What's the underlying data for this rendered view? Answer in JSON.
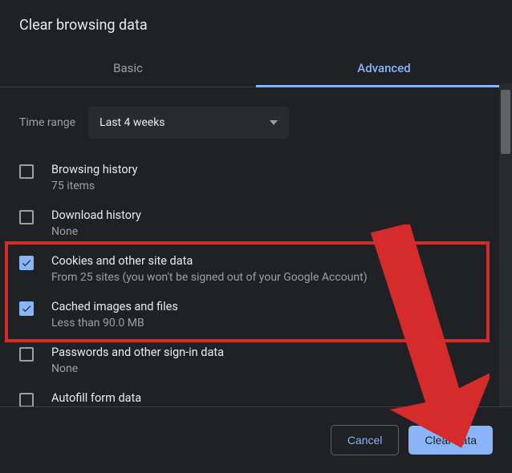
{
  "title": "Clear browsing data",
  "tabs": {
    "basic": "Basic",
    "advanced": "Advanced"
  },
  "time": {
    "label": "Time range",
    "value": "Last 4 weeks"
  },
  "items": [
    {
      "title": "Browsing history",
      "sub": "75 items",
      "checked": false
    },
    {
      "title": "Download history",
      "sub": "None",
      "checked": false
    },
    {
      "title": "Cookies and other site data",
      "sub": "From 25 sites (you won't be signed out of your Google Account)",
      "checked": true
    },
    {
      "title": "Cached images and files",
      "sub": "Less than 90.0 MB",
      "checked": true
    },
    {
      "title": "Passwords and other sign-in data",
      "sub": "None",
      "checked": false
    },
    {
      "title": "Autofill form data",
      "sub": "",
      "checked": false
    }
  ],
  "buttons": {
    "cancel": "Cancel",
    "clear": "Clear data"
  }
}
